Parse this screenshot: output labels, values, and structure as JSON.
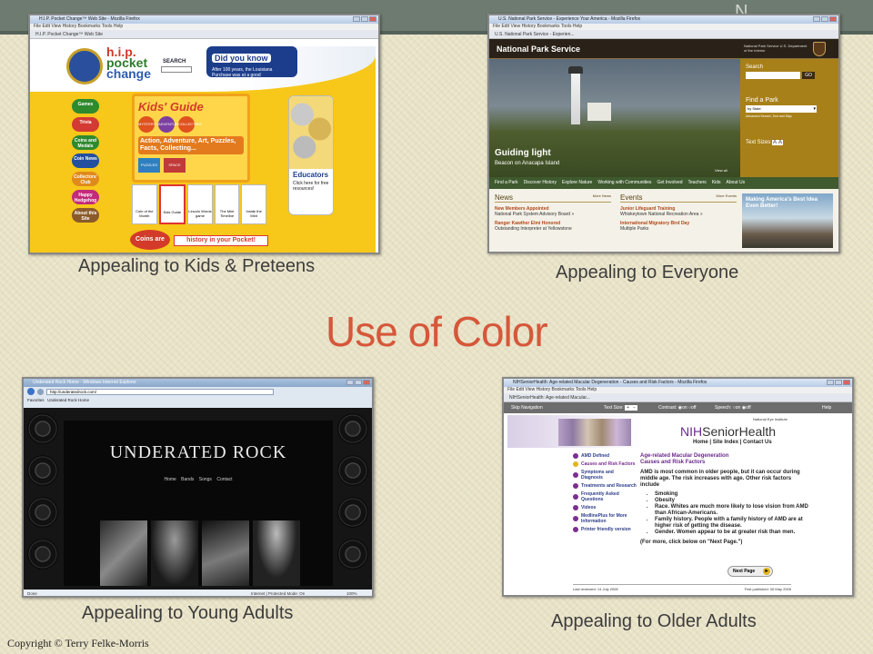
{
  "slide": {
    "title": "Use of Color",
    "copyright": "Copyright © Terry Felke-Morris",
    "corner_mark": "N"
  },
  "panels": {
    "kids": {
      "caption": "Appealing to Kids & Preteens",
      "window_title": "H.I.P. Pocket Change™ Web Site - Mozilla Firefox",
      "menu": "File  Edit  View  History  Bookmarks  Tools  Help",
      "tab": "H.I.P. Pocket Change™ Web Site",
      "logo_line1": "h.i.p.",
      "logo_line2": "pocket",
      "logo_line3": "change",
      "search_label": "SEARCH",
      "did_you_know": "Did you know",
      "did_you_know_text": "After 100 years, the Louisiana Purchase was at a good",
      "nav": [
        "Games",
        "Trivia",
        "Coins and Medals",
        "Coin News",
        "Collectors' Club",
        "Happy Hedgehog",
        "About this Site"
      ],
      "guide_title": "Kids' Guide",
      "guide_text": "Action, Adventure, Art, Puzzles, Facts, Collecting...",
      "guide_tags": [
        "MYSTERY",
        "ADVENTURE",
        "PUZZLES",
        "SPACE",
        "COLLECTING"
      ],
      "thumbs": [
        "Coin of the Month",
        "Kids Guide",
        "Lincoln Words game",
        "The Mint Timeline",
        "Inside the Mint"
      ],
      "educators_title": "Educators",
      "educators_text": "Click here for free resources!",
      "bottom_left": "Coins are",
      "bottom_right": "history in your Pocket!"
    },
    "nps": {
      "caption": "Appealing to Everyone",
      "window_title": "U.S. National Park Service - Experience Your America - Mozilla Firefox",
      "menu": "File  Edit  View  History  Bookmarks  Tools  Help",
      "tab": "U.S. National Park Service - Experien...",
      "site_name": "National Park Service",
      "dept": "National Park Service U.S. Department of the Interior",
      "search_label": "Search",
      "go": "GO",
      "find_park": "Find a Park",
      "by_state": "by State",
      "advanced": "Advanced Search, Tool and Map",
      "text_sizes": "Text Sizes",
      "hero_title": "Guiding light",
      "hero_sub": "Beacon on Anacapa Island",
      "view_all": "View all",
      "nav": [
        "Find a Park",
        "Discover History",
        "Explore Nature",
        "Working with Communities",
        "Get Involved",
        "Teachers",
        "Kids",
        "About Us"
      ],
      "news_title": "News",
      "news_more": "More News",
      "events_title": "Events",
      "events_more": "More Events",
      "news": [
        {
          "head": "New Members Appointed",
          "sub": "National Park System Advisory Board »"
        },
        {
          "head": "Ranger Kawther Elmi Honored",
          "sub": "Outstanding Interpreter at Yellowstone"
        }
      ],
      "events": [
        {
          "head": "Junior Lifeguard Training",
          "sub": "Whiskeytown National Recreation Area »"
        },
        {
          "head": "International Migratory Bird Day",
          "sub": "Multiple Parks"
        }
      ],
      "promo": "Making America's Best Idea Even Better!"
    },
    "rock": {
      "caption": "Appealing to Young Adults",
      "window_title": "Underated Rock Home - Windows Internet Explorer",
      "address": "http://underatedrock.com/",
      "tab": "Underated Rock Home",
      "favorites": "Favorites",
      "site_title": "UNDERATED ROCK",
      "nav": [
        "Home",
        "Bands",
        "Songs",
        "Contact"
      ],
      "status_left": "Done",
      "status_right": "Internet | Protected Mode: On",
      "zoom": "100%"
    },
    "nih": {
      "caption": "Appealing to Older Adults",
      "window_title": "NIHSeniorHealth: Age-related Macular Degeneration - Causes and Risk Factors - Mozilla Firefox",
      "menu": "File  Edit  View  History  Bookmarks  Tools  Help",
      "tab": "NIHSeniorHealth: Age-related Macular...",
      "skip": "Skip Navigation",
      "text_size": "Text Size:",
      "contrast": "Contrast:",
      "speech": "Speech:",
      "on": "on",
      "off": "off",
      "help": "Help",
      "nei": "National Eye Institute",
      "brand_nih": "NIH",
      "brand_name": "SeniorHealth",
      "links": [
        "Home",
        "Site Index",
        "Contact Us"
      ],
      "heading1": "Age-related Macular Degeneration",
      "heading2": "Causes and Risk Factors",
      "menu_items": [
        "AMD Defined",
        "Causes and Risk Factors",
        "Symptoms and Diagnosis",
        "Treatments and Research",
        "Frequently Asked Questions",
        "Videos",
        "MedlinePlus for More Information",
        "Printer friendly version"
      ],
      "body": "AMD is most common in older people, but it can occur during middle age. The risk increases with age. Other risk factors include",
      "bullets": [
        "Smoking",
        "Obesity",
        "Race. Whites are much more likely to lose vision from AMD than African-Americans.",
        "Family history. People with a family history of AMD are at higher risk of getting the disease.",
        "Gender. Women appear to be at greater risk than men."
      ],
      "more": "(For more, click below on \"Next Page.\")",
      "next": "Next Page",
      "reviewed": "Last reviewed: 14 July 2008",
      "published": "First published: 06 May 2005"
    }
  },
  "colors": {
    "title": "#d6573a",
    "kids_bg": "#f7c71a",
    "nps_brown": "#4a3a22",
    "nps_gold": "#b8860b",
    "nih_purple": "#7a2f8e"
  }
}
